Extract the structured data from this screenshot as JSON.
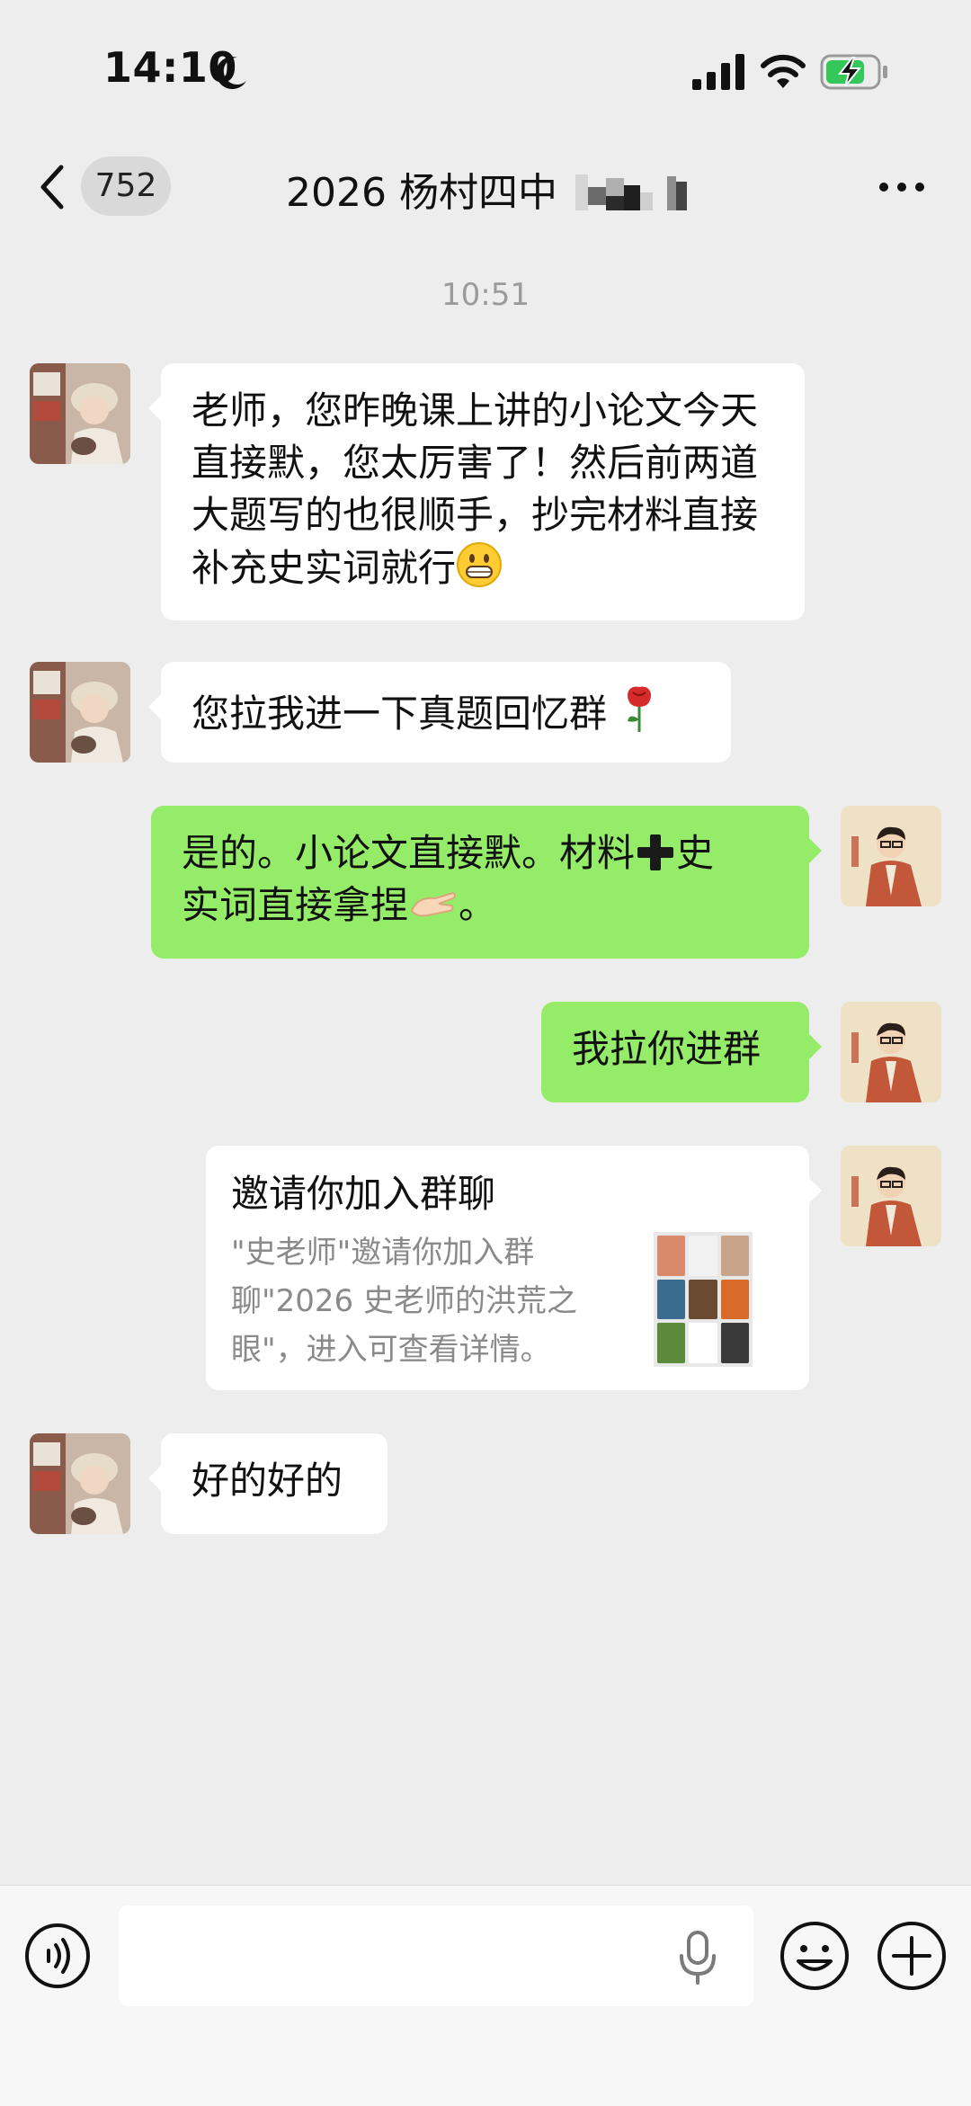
{
  "status_bar": {
    "time": "14:10",
    "icons": [
      "moon-icon",
      "signal-icon",
      "wifi-icon",
      "battery-charging-icon"
    ],
    "battery_color": "#34c759"
  },
  "header": {
    "back_icon": "chevron-left-icon",
    "unread_count": "752",
    "title": "2026 杨村四中",
    "more_icon": "more-icon"
  },
  "chat": {
    "timestamp": "10:51",
    "messages": [
      {
        "side": "left",
        "text": "老师，您昨晚课上讲的小论文今天直接默，您太厉害了！然后前两道大题写的也很顺手，抄完材料直接补充史实词就行",
        "emoji": "grinning-face-icon"
      },
      {
        "side": "left",
        "text": "您拉我进一下真题回忆群",
        "emoji": "rose-icon"
      },
      {
        "side": "right",
        "text_a": "是的。小论文直接默。材料",
        "text_b": "史",
        "text_c": "实词直接拿捏",
        "text_d": "。",
        "emojis": [
          "plus-sign-icon",
          "pinching-hand-icon"
        ]
      },
      {
        "side": "right",
        "text": "我拉你进群"
      },
      {
        "side": "right",
        "type": "group-invite-card",
        "card_title": "邀请你加入群聊",
        "card_desc": "\"史老师\"邀请你加入群聊\"2026 史老师的洪荒之眼\"，进入可查看详情。"
      },
      {
        "side": "left",
        "text": "好的好的"
      }
    ],
    "colors": {
      "background": "#ededed",
      "received_bubble": "#ffffff",
      "sent_bubble": "#95ec69",
      "timestamp": "#9a9a9a"
    }
  },
  "input_bar": {
    "voice_icon": "voice-icon",
    "input_value": "",
    "mic_icon": "microphone-icon",
    "emoji_icon": "emoji-icon",
    "add_icon": "plus-icon"
  }
}
